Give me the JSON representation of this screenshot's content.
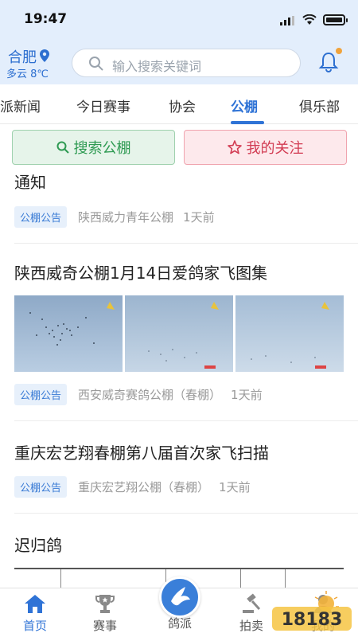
{
  "status_bar": {
    "time": "19:47"
  },
  "header": {
    "city": "合肥",
    "weather": "多云 8℃",
    "search_placeholder": "输入搜索关键词"
  },
  "tabs": [
    {
      "label": "派新闻",
      "active": false
    },
    {
      "label": "今日赛事",
      "active": false
    },
    {
      "label": "协会",
      "active": false
    },
    {
      "label": "公棚",
      "active": true
    },
    {
      "label": "俱乐部",
      "active": false
    }
  ],
  "actions": {
    "search_label": "搜索公棚",
    "follow_label": "我的关注"
  },
  "feed": [
    {
      "title": "通知",
      "tag": "公棚公告",
      "source": "陕西威力青年公棚",
      "time": "1天前"
    },
    {
      "title": "陕西威奇公棚1月14日爱鸽家飞图集",
      "tag": "公棚公告",
      "source": "西安威奇赛鸽公棚（春棚）",
      "time": "1天前"
    },
    {
      "title": "重庆宏艺翔春棚第八届首次家飞扫描",
      "tag": "公棚公告",
      "source": "重庆宏艺翔公棚（春棚）",
      "time": "1天前"
    },
    {
      "title": "迟归鸽",
      "tag": "",
      "source": "",
      "time": ""
    }
  ],
  "bottom_nav": [
    {
      "label": "首页",
      "icon": "home-icon",
      "active": true
    },
    {
      "label": "赛事",
      "icon": "trophy-icon",
      "active": false
    },
    {
      "label": "鸽派",
      "icon": "dove-icon",
      "active": false
    },
    {
      "label": "拍卖",
      "icon": "gavel-icon",
      "active": false
    },
    {
      "label": "我的",
      "icon": "user-icon",
      "active": false
    }
  ],
  "watermark": "18183",
  "colors": {
    "accent": "#2f73d6",
    "green": "#2e9a52",
    "red": "#d23b52"
  }
}
